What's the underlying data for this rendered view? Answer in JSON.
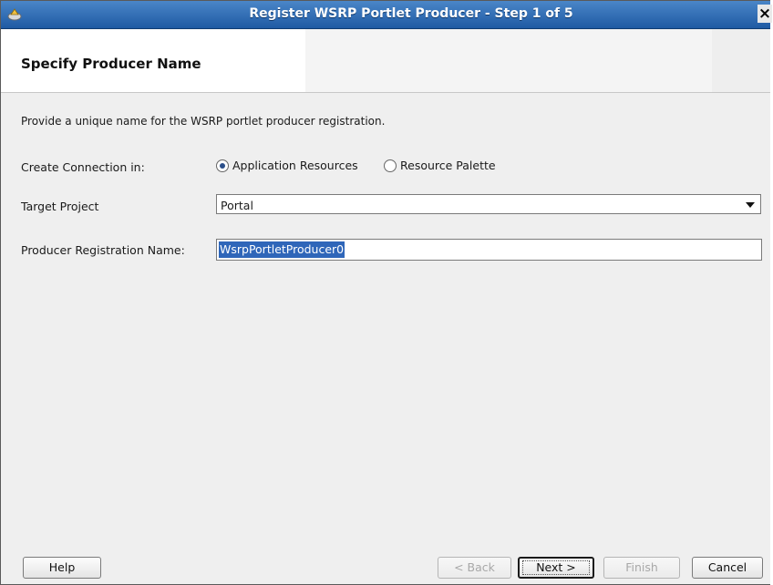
{
  "window": {
    "title": "Register WSRP Portlet Producer - Step 1 of 5",
    "close_glyph": "×",
    "title_color": "#2a64ad"
  },
  "header": {
    "heading": "Specify Producer Name"
  },
  "form": {
    "description": "Provide a unique name for the WSRP portlet producer registration.",
    "connection_label": "Create Connection in:",
    "connection_options": [
      {
        "label": "Application Resources",
        "selected": true
      },
      {
        "label": "Resource Palette",
        "selected": false
      }
    ],
    "target_project_label": "Target Project",
    "target_project_value": "Portal",
    "registration_name_label": "Producer Registration Name:",
    "registration_name_value": "WsrpPortletProducer0"
  },
  "footer": {
    "help": "Help",
    "back": "< Back",
    "next": "Next >",
    "finish": "Finish",
    "cancel": "Cancel"
  },
  "icons": {
    "app": "wizard-app-icon",
    "close": "close-icon",
    "dropdown": "chevron-down-icon"
  }
}
